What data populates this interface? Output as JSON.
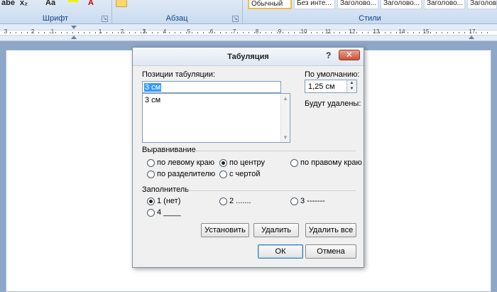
{
  "ribbon": {
    "font_group_label": "Шрифт",
    "paragraph_group_label": "Абзац",
    "styles_group_label": "Стили",
    "font_buttons": [
      "abe",
      "x₂",
      "Aa"
    ],
    "styles": [
      "Обычный",
      "Без инте...",
      "Заголово...",
      "Заголово...",
      "Заголово...",
      "Заголово..."
    ]
  },
  "ruler": {
    "numbers": [
      "3",
      "2",
      "1",
      "1",
      "2",
      "3",
      "4",
      "5",
      "6",
      "7",
      "8",
      "9",
      "10",
      "11",
      "12",
      "13",
      "14",
      "15",
      "17"
    ]
  },
  "dialog": {
    "title": "Табуляция",
    "help": "?",
    "close": "✕",
    "tab_positions_label": "Позиции табуляции:",
    "tab_position_value": "3 см",
    "tab_list": [
      "3 см"
    ],
    "default_label": "По умолчанию:",
    "default_value": "1,25 см",
    "to_be_cleared_label": "Будут удалены:",
    "alignment_label": "Выравнивание",
    "alignment_options": [
      {
        "label": "по левому краю",
        "selected": false
      },
      {
        "label": "по центру",
        "selected": true
      },
      {
        "label": "по правому краю",
        "selected": false
      },
      {
        "label": "по разделителю",
        "selected": false
      },
      {
        "label": "с чертой",
        "selected": false
      }
    ],
    "leader_label": "Заполнитель",
    "leader_options": [
      {
        "label": "1 (нет)",
        "selected": true
      },
      {
        "label": "2 .......",
        "selected": false
      },
      {
        "label": "3 -------",
        "selected": false
      },
      {
        "label": "4 ____",
        "selected": false
      }
    ],
    "buttons": {
      "set": "Установить",
      "clear": "Удалить",
      "clear_all": "Удалить все",
      "ok": "ОК",
      "cancel": "Отмена"
    }
  },
  "colors": {
    "ribbon_caption": "#15428b",
    "selection": "#3399ff",
    "close_button": "#c8533a"
  }
}
